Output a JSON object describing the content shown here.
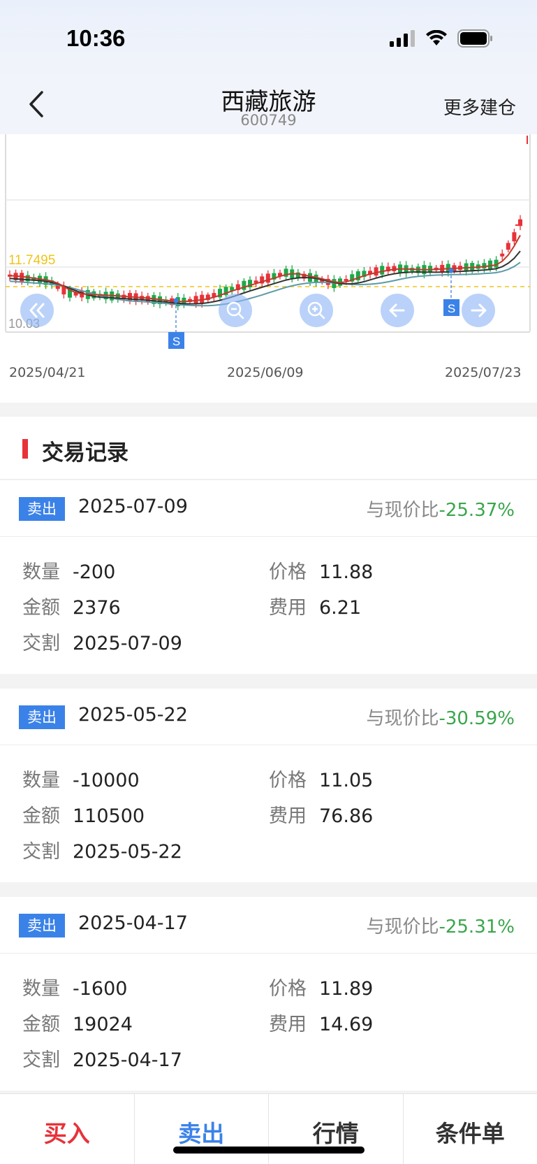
{
  "status": {
    "time": "10:36"
  },
  "nav": {
    "title": "西藏旅游",
    "code": "600749",
    "more": "更多建仓"
  },
  "chart": {
    "ref_price_label": "11.7495",
    "low_label": "10.03",
    "dates": [
      "2025/04/21",
      "2025/06/09",
      "2025/07/23"
    ],
    "marker": "S",
    "colors": {
      "up": "#e8323a",
      "down": "#1ea84a",
      "ref_line": "#f0c419",
      "ma5": "#c0392b",
      "ma10": "#333333",
      "ma20": "#5b9aa8"
    }
  },
  "section": {
    "title": "交易记录"
  },
  "trades": [
    {
      "type": "卖出",
      "date": "2025-07-09",
      "compare_label": "与现价比",
      "compare_pct": "-25.37%",
      "qty_label": "数量",
      "qty": "-200",
      "price_label": "价格",
      "price": "11.88",
      "amount_label": "金额",
      "amount": "2376",
      "fee_label": "费用",
      "fee": "6.21",
      "settle_label": "交割",
      "settle": "2025-07-09"
    },
    {
      "type": "卖出",
      "date": "2025-05-22",
      "compare_label": "与现价比",
      "compare_pct": "-30.59%",
      "qty_label": "数量",
      "qty": "-10000",
      "price_label": "价格",
      "price": "11.05",
      "amount_label": "金额",
      "amount": "110500",
      "fee_label": "费用",
      "fee": "76.86",
      "settle_label": "交割",
      "settle": "2025-05-22"
    },
    {
      "type": "卖出",
      "date": "2025-04-17",
      "compare_label": "与现价比",
      "compare_pct": "-25.31%",
      "qty_label": "数量",
      "qty": "-1600",
      "price_label": "价格",
      "price": "11.89",
      "amount_label": "金额",
      "amount": "19024",
      "fee_label": "费用",
      "fee": "14.69",
      "settle_label": "交割",
      "settle": "2025-04-17"
    }
  ],
  "bottom": {
    "buy": "买入",
    "sell": "卖出",
    "quote": "行情",
    "condition": "条件单"
  },
  "bottom_colors": {
    "buy": "#e8323a",
    "sell": "#3b82e8",
    "other": "#333333"
  }
}
